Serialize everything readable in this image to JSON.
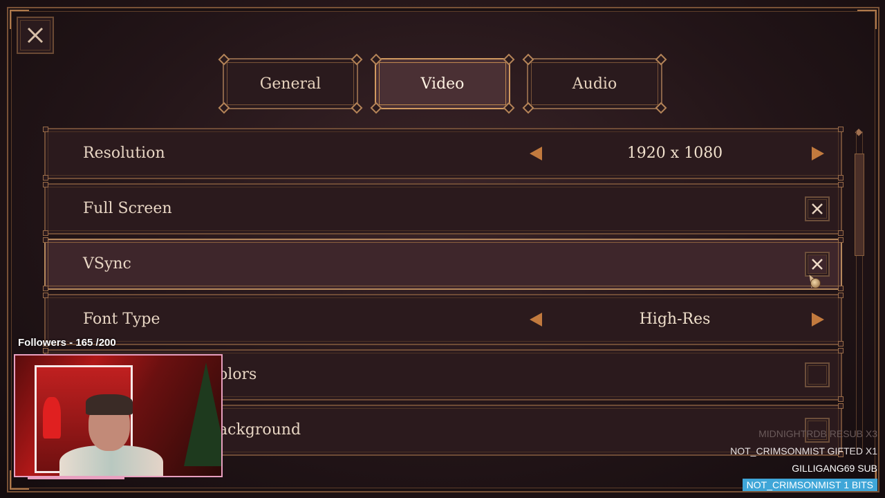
{
  "tabs": [
    {
      "label": "General",
      "active": false
    },
    {
      "label": "Video",
      "active": true
    },
    {
      "label": "Audio",
      "active": false
    }
  ],
  "settings": [
    {
      "label": "Resolution",
      "type": "selector",
      "value": "1920 x 1080"
    },
    {
      "label": "Full Screen",
      "type": "checkbox",
      "checked": true
    },
    {
      "label": "VSync",
      "type": "checkbox",
      "checked": true,
      "hovered": true
    },
    {
      "label": "Font Type",
      "type": "selector",
      "value": "High-Res"
    },
    {
      "label": "olors",
      "type": "checkbox",
      "checked": false
    },
    {
      "label": "ackground",
      "type": "checkbox",
      "checked": false
    }
  ],
  "overlay": {
    "followers": "Followers - 165 /200",
    "feed": [
      "MIDNIGHTRDB  RESUB X3",
      "NOT_CRIMSONMIST  GIFTED X1",
      "GILLIGANG69  SUB",
      "NOT_CRIMSONMIST  1 BITS"
    ]
  },
  "colors": {
    "accent": "#c27a3e",
    "tab_active_border": "#d29a60",
    "bits_badge": "#3fa6d8"
  },
  "icons": {
    "close": "x-close-icon",
    "check": "x-check-icon",
    "prev": "left-arrow-icon",
    "next": "right-arrow-icon"
  }
}
